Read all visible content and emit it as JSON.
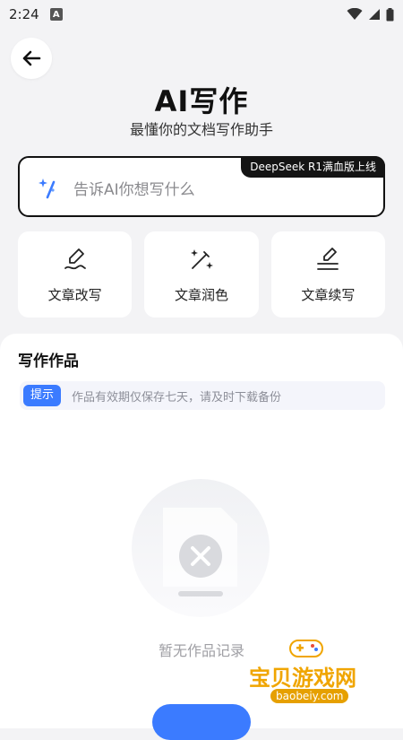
{
  "status": {
    "time": "2:24"
  },
  "header": {
    "title": "AI写作",
    "subtitle": "最懂你的文档写作助手"
  },
  "prompt": {
    "placeholder": "告诉AI你想写什么",
    "model_badge": "DeepSeek R1满血版上线"
  },
  "actions": [
    {
      "label": "文章改写",
      "icon": "pen-curve-icon"
    },
    {
      "label": "文章润色",
      "icon": "magic-wand-icon"
    },
    {
      "label": "文章续写",
      "icon": "pen-lines-icon"
    }
  ],
  "works": {
    "title": "写作作品",
    "tip_badge": "提示",
    "tip_text": "作品有效期仅保存七天，请及时下载备份",
    "empty_text": "暂无作品记录"
  },
  "watermark": {
    "text": "宝贝游戏网",
    "url": "baobeiy.com"
  },
  "colors": {
    "accent": "#3b7bff",
    "badge_bg": "#141414"
  }
}
